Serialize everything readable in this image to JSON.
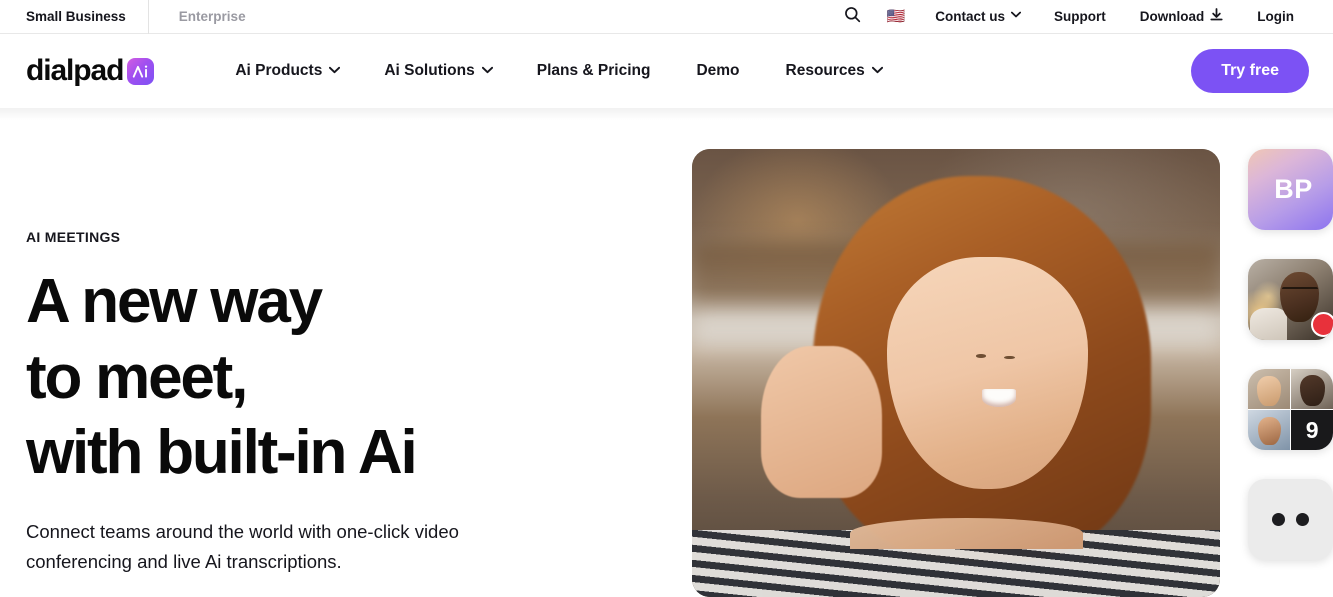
{
  "utility_bar": {
    "audience_tabs": [
      {
        "label": "Small Business",
        "active": true
      },
      {
        "label": "Enterprise",
        "active": false
      }
    ],
    "search_icon": "search-icon",
    "locale_flag": "🇺🇸",
    "items": [
      {
        "label": "Contact us",
        "has_caret": true
      },
      {
        "label": "Support",
        "has_caret": false
      },
      {
        "label": "Download",
        "has_caret": false,
        "icon": "download-icon"
      },
      {
        "label": "Login",
        "has_caret": false
      }
    ]
  },
  "header": {
    "logo_text": "dialpad",
    "logo_badge_icon": "dialpad-ai-badge-icon",
    "nav": [
      {
        "label": "Ai Products",
        "has_caret": true
      },
      {
        "label": "Ai Solutions",
        "has_caret": true
      },
      {
        "label": "Plans & Pricing",
        "has_caret": false
      },
      {
        "label": "Demo",
        "has_caret": false
      },
      {
        "label": "Resources",
        "has_caret": true
      }
    ],
    "cta_label": "Try free",
    "cta_color": "#7c52f4"
  },
  "hero": {
    "eyebrow": "AI MEETINGS",
    "title_lines": [
      "A new way",
      "to meet,",
      "with built-in Ai"
    ],
    "subtitle": "Connect teams around the world with one-click video conferencing and live Ai transcriptions.",
    "image_alt": "Smiling woman with red hair waving on a video call"
  },
  "participants": [
    {
      "type": "initials",
      "label": "BP",
      "name": "participant-tile-initials"
    },
    {
      "type": "photo",
      "label": "",
      "name": "participant-tile-person",
      "badge": "recording-badge"
    },
    {
      "type": "grid",
      "label": "9",
      "name": "participant-tile-grid"
    },
    {
      "type": "dots",
      "label": "",
      "name": "participant-tile-more"
    }
  ],
  "colors": {
    "accent_purple": "#7c52f4",
    "text_primary": "#16161d",
    "text_muted": "#9a9aa2",
    "badge_red": "#e8313b"
  }
}
